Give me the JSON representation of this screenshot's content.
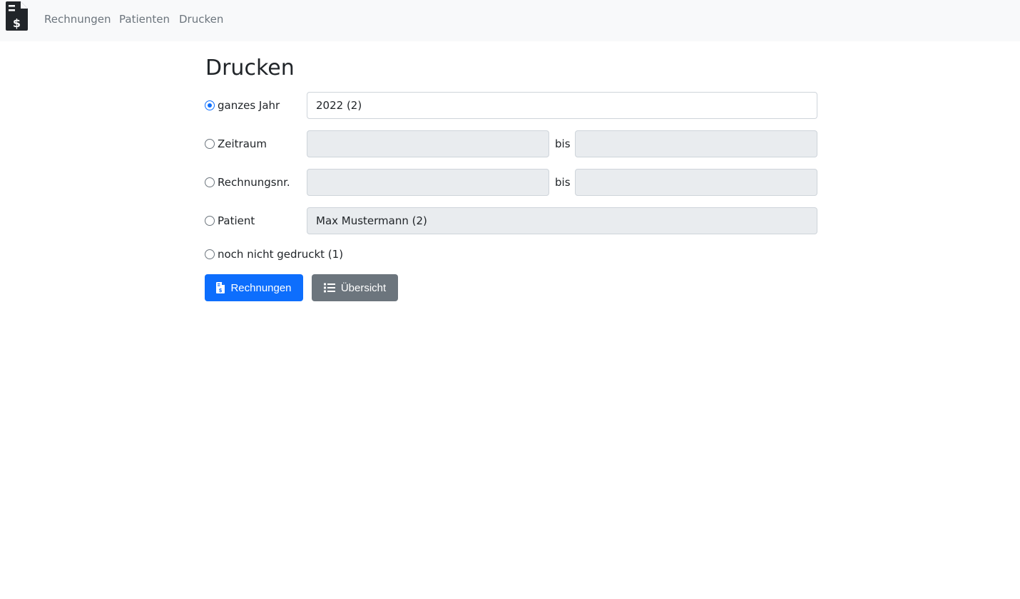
{
  "navbar": {
    "brand_icon": "file-invoice-dollar-icon",
    "links": [
      "Rechnungen",
      "Patienten",
      "Drucken"
    ]
  },
  "page": {
    "title": "Drucken"
  },
  "options": {
    "year": {
      "label": "ganzes Jahr",
      "value": "2022 (2)",
      "checked": true
    },
    "zeitraum": {
      "label": "Zeitraum",
      "from": "",
      "to": "",
      "separator": "bis",
      "checked": false
    },
    "rechnungsnr": {
      "label": "Rechnungsnr.",
      "from": "",
      "to": "",
      "separator": "bis",
      "checked": false
    },
    "patient": {
      "label": "Patient",
      "value": "Max Mustermann (2)",
      "checked": false
    },
    "unprinted": {
      "label": "noch nicht gedruckt (1)",
      "checked": false
    }
  },
  "buttons": {
    "invoices": {
      "label": "Rechnungen",
      "icon": "file-invoice-dollar-icon"
    },
    "overview": {
      "label": "Übersicht",
      "icon": "list-icon"
    }
  },
  "colors": {
    "primary": "#0d6efd",
    "secondary": "#6c757d",
    "navbar_bg": "#f8f9fa",
    "disabled_bg": "#e9ecef"
  }
}
